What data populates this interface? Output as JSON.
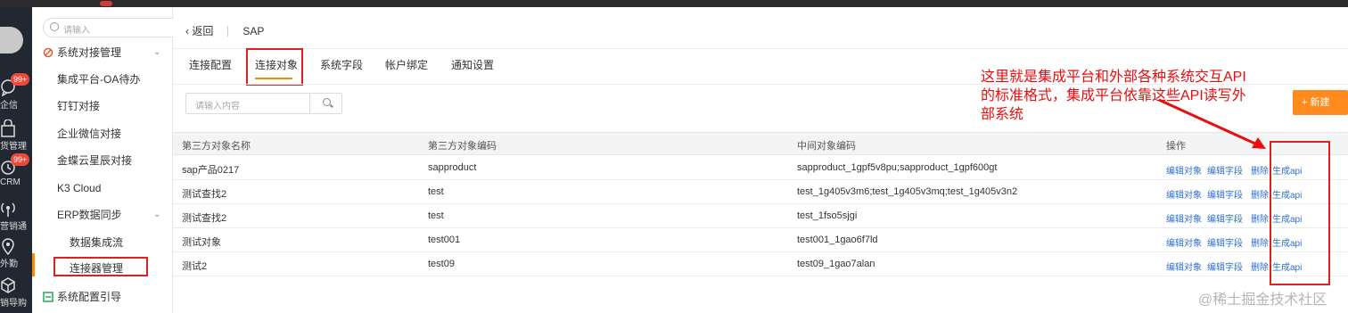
{
  "rail": {
    "badge_top": "99+",
    "items": [
      {
        "label": "企信",
        "icon": "chat-icon"
      },
      {
        "label": "货管理",
        "icon": "bag-icon"
      },
      {
        "label": "CRM",
        "icon": "clock-icon"
      },
      {
        "label": "营销通",
        "icon": "broadcast-icon"
      },
      {
        "label": "外勤",
        "icon": "location-icon"
      },
      {
        "label": "销导购",
        "icon": "box-icon"
      }
    ],
    "badge_crm": "99+"
  },
  "sidebar": {
    "search_placeholder": "请输入",
    "items": [
      {
        "label": "系统对接管理"
      },
      {
        "label": "集成平台-OA待办"
      },
      {
        "label": "钉钉对接"
      },
      {
        "label": "企业微信对接"
      },
      {
        "label": "金蝶云星辰对接"
      },
      {
        "label": "K3 Cloud"
      },
      {
        "label": "ERP数据同步"
      },
      {
        "label": "数据集成流"
      },
      {
        "label": "连接器管理"
      },
      {
        "label": "系统配置引导"
      }
    ]
  },
  "breadcrumb": {
    "back": "返回",
    "title": "SAP"
  },
  "tabs": [
    "连接配置",
    "连接对象",
    "系统字段",
    "帐户绑定",
    "通知设置"
  ],
  "search": {
    "placeholder": "请输入内容"
  },
  "new_button": "+ 新建",
  "annotation": "这里就是集成平台和外部各种系统交互API的标准格式，集成平台依靠这些API读写外部系统",
  "table": {
    "headers": [
      "第三方对象名称",
      "第三方对象编码",
      "中间对象编码",
      "操作"
    ],
    "actions": [
      "编辑对象",
      "编辑字段",
      "删除",
      "生成api"
    ],
    "rows": [
      [
        "sap产品0217",
        "sapproduct",
        "sapproduct_1gpf5v8pu;sapproduct_1gpf600gt"
      ],
      [
        "测试查找2",
        "test",
        "test_1g405v3m6;test_1g405v3mq;test_1g405v3n2"
      ],
      [
        "测试查找2",
        "test",
        "test_1fso5sjgi"
      ],
      [
        "测试对象",
        "test001",
        "test001_1gao6f7ld"
      ],
      [
        "测试2",
        "test09",
        "test09_1gao7alan"
      ]
    ]
  },
  "watermark": "@稀土掘金技术社区",
  "colors": {
    "accent": "#ff8a00",
    "annotation": "#e80e0e",
    "link": "#2f6fd1",
    "rail": "#222831"
  }
}
